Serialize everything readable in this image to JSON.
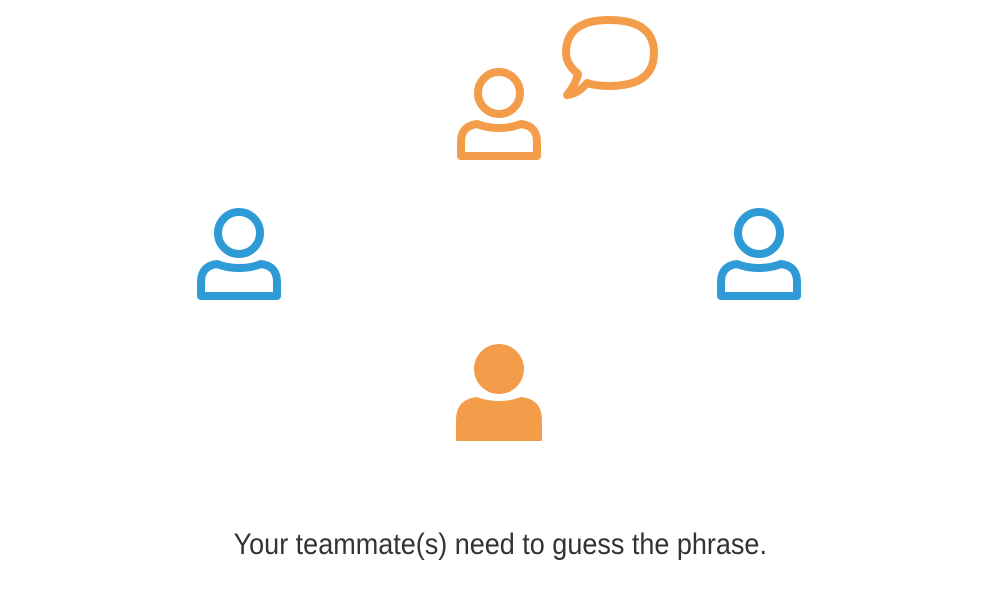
{
  "colors": {
    "speaker": "#F39C4A",
    "teammate": "#2E9BD6",
    "text": "#333333"
  },
  "players": [
    {
      "role": "speaker",
      "icon": "person-outline-icon",
      "speaking": true
    },
    {
      "role": "teammate",
      "icon": "person-outline-icon"
    },
    {
      "role": "teammate",
      "icon": "person-outline-icon"
    },
    {
      "role": "you",
      "icon": "person-filled-icon"
    }
  ],
  "caption": "Your teammate(s) need to guess the phrase."
}
